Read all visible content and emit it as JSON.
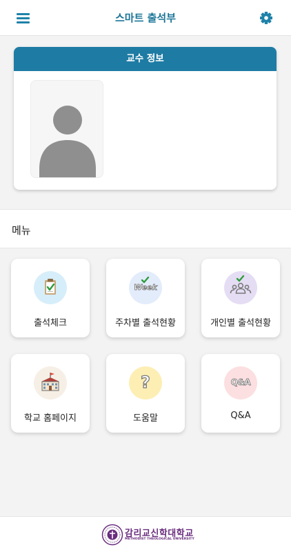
{
  "header": {
    "title": "스마트 출석부",
    "menu_icon": "hamburger-menu-icon",
    "settings_icon": "gear-icon",
    "accent_color": "#1e82a9"
  },
  "professor": {
    "card_title": "교수 정보",
    "photo_icon": "person-placeholder-icon"
  },
  "menu": {
    "title": "메뉴",
    "items": [
      {
        "label": "출석체크",
        "icon": "clipboard-check-icon"
      },
      {
        "label": "주차별 출석현황",
        "icon": "week-check-icon",
        "icon_text": "Week"
      },
      {
        "label": "개인별 출석현황",
        "icon": "people-check-icon"
      },
      {
        "label": "학교 홈페이지",
        "icon": "school-building-icon"
      },
      {
        "label": "도움말",
        "icon": "help-question-icon"
      },
      {
        "label": "Q&A",
        "icon": "qna-icon",
        "icon_text": "Q&A"
      }
    ]
  },
  "footer": {
    "logo_name": "감리교신학대학교",
    "logo_subtitle": "METHODIST THEOLOGICAL UNIVERSITY",
    "brand_color": "#6a2d7e"
  }
}
